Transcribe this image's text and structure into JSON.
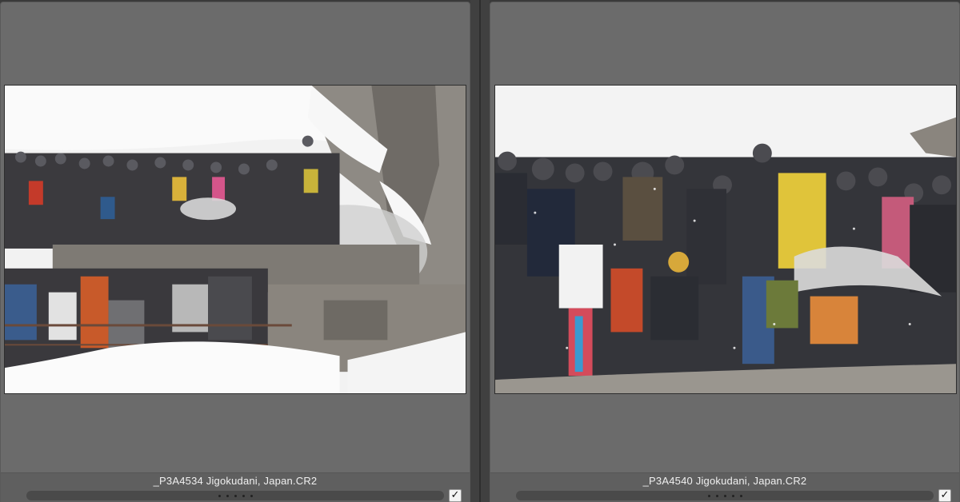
{
  "left_panel": {
    "filename": "_P3A4534 Jigokudani, Japan.CR2",
    "image_description_icon": "photo-thumbnail",
    "checkbox_checked": true,
    "checkbox_glyph": "✓"
  },
  "right_panel": {
    "filename": "_P3A4540 Jigokudani, Japan.CR2",
    "image_description_icon": "photo-thumbnail",
    "checkbox_checked": true,
    "checkbox_glyph": "✓"
  },
  "colors": {
    "panel_bg": "#6b6b6b",
    "app_bg": "#3a3a3a",
    "filename_text": "#f0f0f0"
  }
}
